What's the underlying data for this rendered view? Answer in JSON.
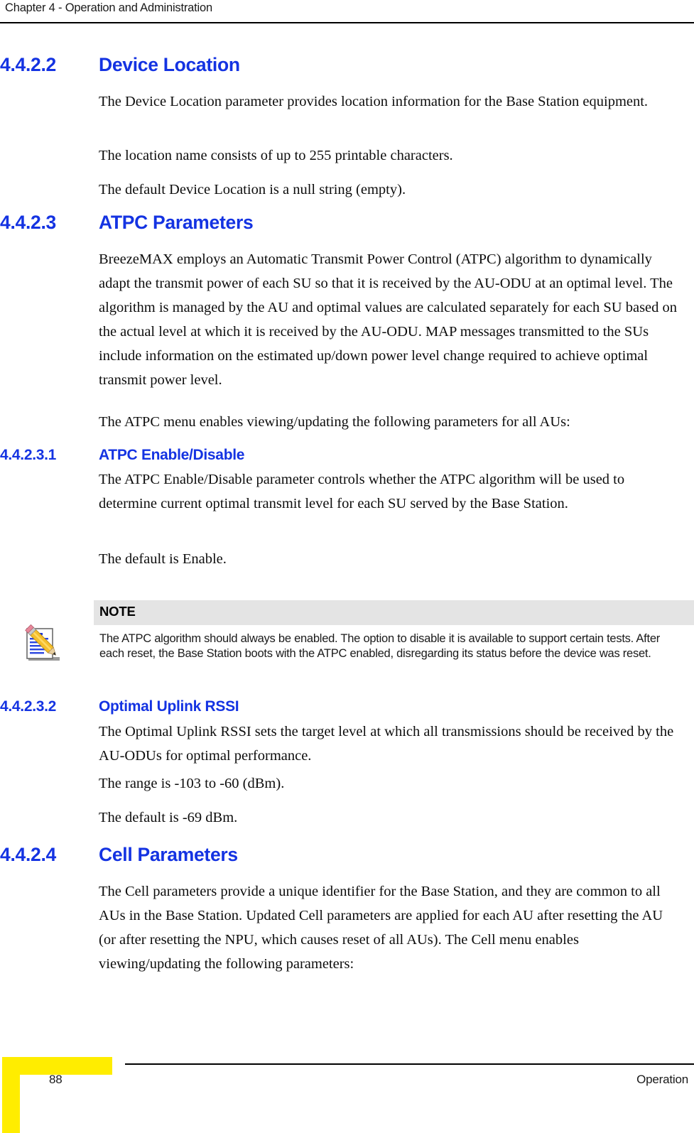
{
  "header": {
    "running_head": "Chapter 4 - Operation and Administration"
  },
  "sections": [
    {
      "number": "4.4.2.2",
      "title": "Device Location",
      "paragraphs": [
        "The Device Location parameter provides location information for the Base Station equipment.",
        "The location name consists of up to 255 printable characters.",
        "The default Device Location is a null string (empty)."
      ]
    },
    {
      "number": "4.4.2.3",
      "title": "ATPC Parameters",
      "paragraphs": [
        "BreezeMAX employs an Automatic Transmit Power Control (ATPC) algorithm to dynamically adapt the transmit power of each SU so that it is received by the AU-ODU at an optimal level. The algorithm is managed by the AU and optimal values are calculated separately for each SU based on the actual level at which it is received by the AU-ODU. MAP messages transmitted to the SUs include information on the estimated up/down power level change required to achieve optimal transmit power level.",
        "The ATPC menu enables viewing/updating the following parameters for all AUs:"
      ]
    },
    {
      "number": "4.4.2.3.1",
      "title": "ATPC Enable/Disable",
      "paragraphs": [
        "The ATPC Enable/Disable parameter controls whether the ATPC algorithm will be used to determine current optimal transmit level for each SU served by the Base Station.",
        "The default is Enable."
      ]
    },
    {
      "number": "4.4.2.3.2",
      "title": "Optimal Uplink RSSI",
      "paragraphs": [
        "The Optimal Uplink RSSI sets the target level at which all transmissions should be received by the AU-ODUs for optimal performance.",
        "The range is -103 to -60 (dBm).",
        "The default is -69 dBm."
      ]
    },
    {
      "number": "4.4.2.4",
      "title": "Cell Parameters",
      "paragraphs": [
        "The Cell parameters provide a unique identifier for the Base Station, and they are common to all AUs in the Base Station. Updated Cell parameters are applied for each AU after resetting the AU (or after resetting the NPU, which causes reset of all AUs). The Cell menu enables viewing/updating the following parameters:"
      ]
    }
  ],
  "note": {
    "label": "NOTE",
    "icon": "notepad-pencil-icon",
    "body": "The ATPC algorithm should always be enabled. The option to disable it is available to support certain tests. After each reset, the Base Station boots with the ATPC enabled, disregarding its status before the device was reset.",
    "banner_color": "#e4e4e4"
  },
  "footer": {
    "page_number": "88",
    "section_name": "Operation",
    "corner_color": "#ffed00"
  },
  "theme": {
    "heading_color": "#1433e2",
    "text_color": "#0d0d0d",
    "rule_color": "#000000",
    "background": "#ffffff"
  }
}
